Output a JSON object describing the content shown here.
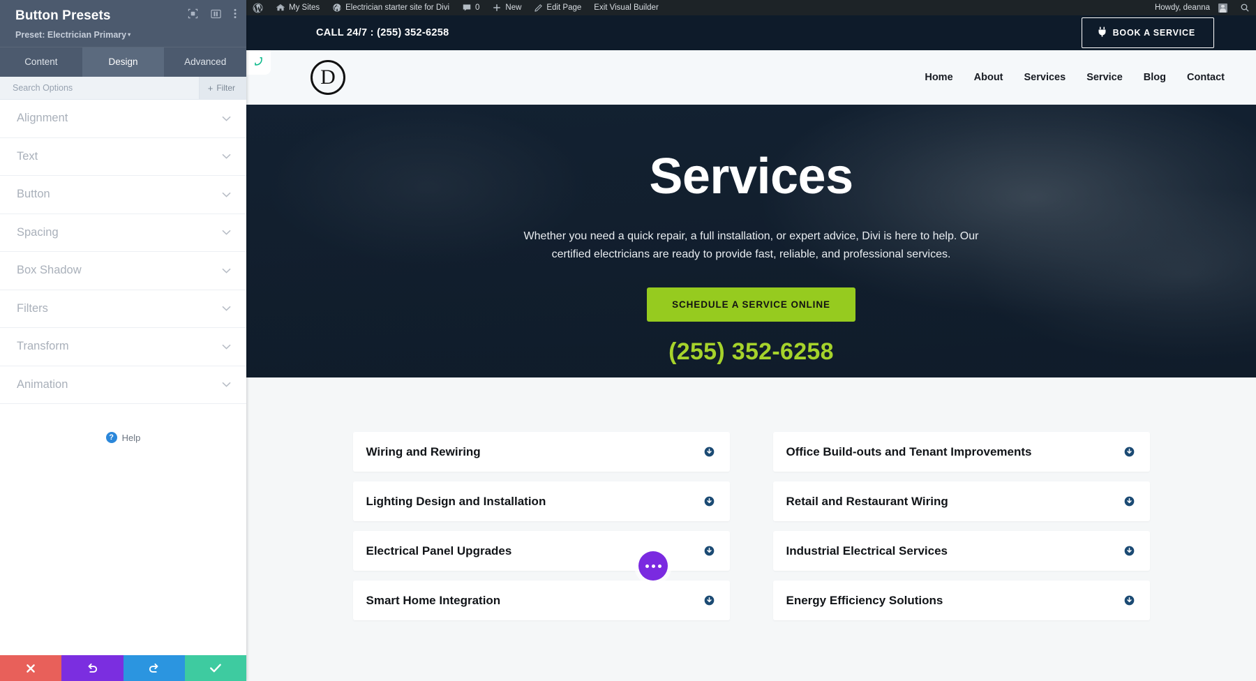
{
  "settings_panel": {
    "title": "Button Presets",
    "subtitle": "Preset: Electrician Primary",
    "caret": "▾",
    "icons": [
      {
        "name": "focus-target-icon"
      },
      {
        "name": "panel-layout-icon"
      },
      {
        "name": "vertical-dots-icon"
      }
    ],
    "tabs": [
      {
        "label": "Content",
        "active": false
      },
      {
        "label": "Design",
        "active": true
      },
      {
        "label": "Advanced",
        "active": false
      }
    ],
    "search": {
      "value": "",
      "placeholder": "Search Options"
    },
    "filter_label": "Filter",
    "filter_plus": "+",
    "sections": [
      {
        "label": "Alignment"
      },
      {
        "label": "Text"
      },
      {
        "label": "Button"
      },
      {
        "label": "Spacing"
      },
      {
        "label": "Box Shadow"
      },
      {
        "label": "Filters"
      },
      {
        "label": "Transform"
      },
      {
        "label": "Animation"
      }
    ],
    "help_label": "Help",
    "help_badge": "?",
    "footer_buttons": [
      {
        "name": "discard-button",
        "icon": "close-x-icon",
        "color": "#e8605a"
      },
      {
        "name": "undo-button",
        "icon": "undo-arrow-icon",
        "color": "#7b2ee0"
      },
      {
        "name": "redo-button",
        "icon": "redo-arrow-icon",
        "color": "#2b95e0"
      },
      {
        "name": "save-button",
        "icon": "checkmark-icon",
        "color": "#3ecba0"
      }
    ]
  },
  "admin_bar": {
    "items": [
      {
        "label": "",
        "icon": "wordpress-logo-icon"
      },
      {
        "label": "My Sites",
        "icon": "sites-icon"
      },
      {
        "label": "Electrician starter site for Divi",
        "icon": "site-home-icon"
      },
      {
        "label": "0",
        "icon": "comment-bubble-icon"
      },
      {
        "label": "New",
        "icon": "plus-icon"
      },
      {
        "label": "Edit Page",
        "icon": "pencil-icon"
      },
      {
        "label": "Exit Visual Builder",
        "icon": ""
      }
    ],
    "howdy": "Howdy, deanna",
    "search_icon": "search-icon"
  },
  "site": {
    "topbar": {
      "phone_text": "CALL 24/7 : (255) 352-6258",
      "book_button": "BOOK A SERVICE",
      "book_icon": "plug-icon"
    },
    "phone_tab_icon": "phone-icon",
    "logo_letter": "D",
    "nav": [
      {
        "label": "Home"
      },
      {
        "label": "About"
      },
      {
        "label": "Services"
      },
      {
        "label": "Service"
      },
      {
        "label": "Blog"
      },
      {
        "label": "Contact"
      }
    ],
    "hero": {
      "title": "Services",
      "subtitle": "Whether you need a quick repair, a full installation, or expert advice, Divi is here to help. Our certified electricians are ready to provide fast, reliable, and professional services.",
      "cta_label": "SCHEDULE A SERVICE ONLINE",
      "phone": "(255) 352-6258",
      "cta_color": "#96cb1f",
      "phone_color": "#a6d32b"
    },
    "toggles": {
      "left": [
        {
          "title": "Wiring and Rewiring"
        },
        {
          "title": "Lighting Design and Installation"
        },
        {
          "title": "Electrical Panel Upgrades"
        },
        {
          "title": "Smart Home Integration"
        }
      ],
      "right": [
        {
          "title": "Office Build-outs and Tenant Improvements"
        },
        {
          "title": "Retail and Restaurant Wiring"
        },
        {
          "title": "Industrial Electrical Services"
        },
        {
          "title": "Energy Efficiency Solutions"
        }
      ],
      "toggle_icon": "circle-down-arrow-icon"
    },
    "fab": {
      "name": "builder-options-fab",
      "icon": "ellipsis-icon"
    }
  }
}
